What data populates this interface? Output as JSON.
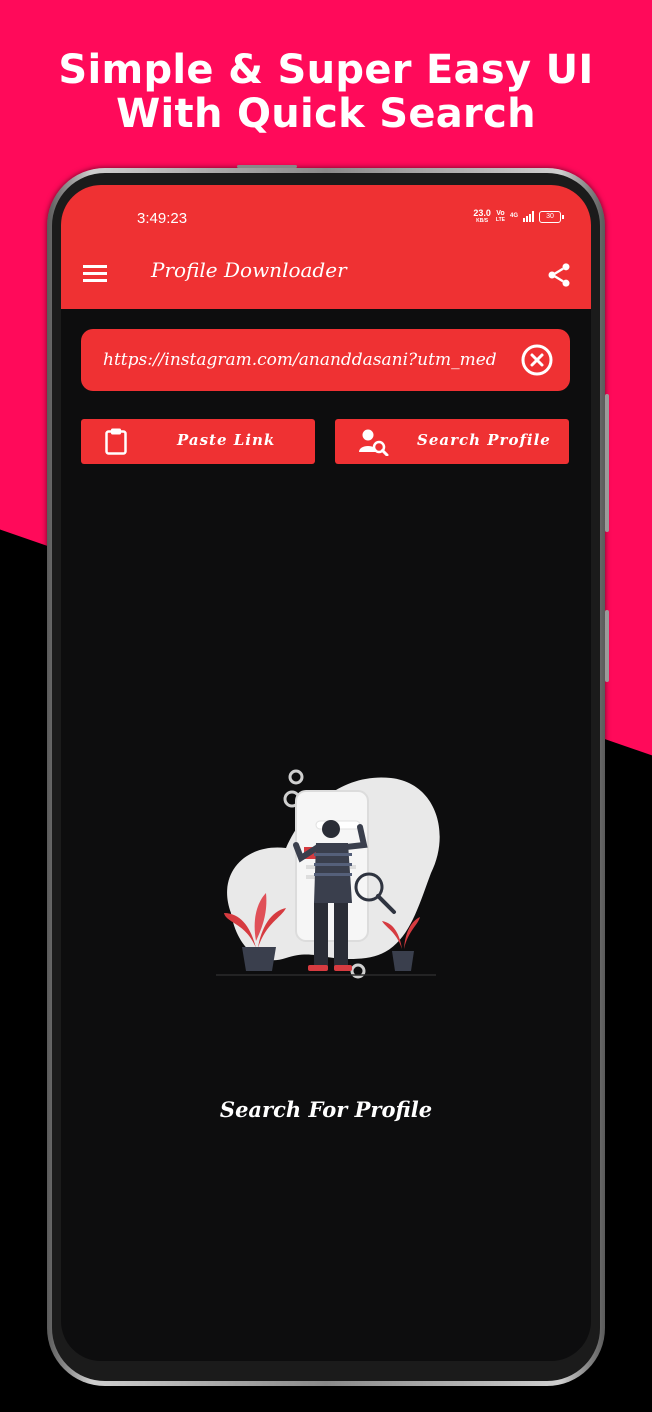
{
  "promo": {
    "headline_line1": "Simple & Super Easy UI",
    "headline_line2": "With Quick Search"
  },
  "colors": {
    "promo_background": "#ff0a5a",
    "app_accent": "#ef3133",
    "screen_background": "#0d0d0e"
  },
  "status_bar": {
    "time": "3:49:23",
    "net_speed": "23.0",
    "net_unit": "KB/S",
    "volte": "Vo",
    "lte": "LTE",
    "network": "4G",
    "battery": "30"
  },
  "app_bar": {
    "title": "Profile Downloader",
    "menu_icon": "menu-icon",
    "share_icon": "share-icon"
  },
  "search": {
    "url_value": "https://instagram.com/ananddasani?utm_med",
    "clear_icon": "clear-icon"
  },
  "buttons": {
    "paste_label": "Paste Link",
    "paste_icon": "clipboard-icon",
    "search_label": "Search Profile",
    "search_icon": "user-search-icon"
  },
  "empty_state": {
    "illustration": "person-searching-illustration",
    "message": "Search For Profile"
  }
}
